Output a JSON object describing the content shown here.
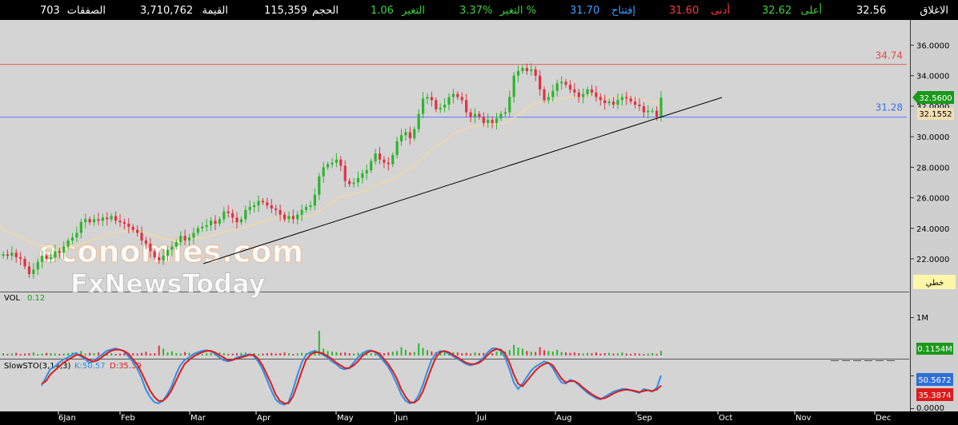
{
  "header": {
    "close_label": "الاغلاق",
    "close_value": "32.56",
    "high_label": "أعلى",
    "high_value": "32.62",
    "low_label": "أدنى",
    "low_value": "31.60",
    "open_label": "إفتتاح",
    "open_value": "31.70",
    "pct_label": "التغير %",
    "pct_value": "3.37%",
    "change_label": "التغير",
    "change_value": "1.06",
    "volume_label": "الحجم",
    "volume_value": "115,359",
    "value_label": "القيمة",
    "value_value": "3,710,762",
    "trades_label": "الصفقات",
    "trades_value": "703"
  },
  "colors": {
    "up": "#2db52d",
    "down": "#dd3344",
    "green_text": "#3fd13f",
    "red_text": "#ff3a3a",
    "blue_text": "#3aa0ff",
    "resistance": "#e06060",
    "support": "#5b7cff",
    "ma": "#efd9a8",
    "trend": "#000000",
    "sto_k": "#2f8fe8",
    "sto_d": "#dd1b1b"
  },
  "price_panel": {
    "resistance_label": "34.74",
    "support_label": "31.28",
    "last_price_badge": "32.5600",
    "ma_badge": "32.1552",
    "linear_badge": "خطي"
  },
  "volume_panel": {
    "label": "VOL",
    "value": "0.12",
    "axis_1m": "1M",
    "badge": "0.1154M"
  },
  "sto_panel": {
    "label": "SlowSTO(3,14,3)",
    "k_text": "K:50.57",
    "d_text": "D:35.39",
    "k_badge": "50.5672",
    "d_badge": "35.3874"
  },
  "watermark": {
    "line1": "economies.com",
    "line2": "FxNewsToday"
  },
  "chart_data": {
    "type": "candlestick",
    "price_ticks": [
      "36.0000",
      "34.0000",
      "32.0000",
      "30.0000",
      "28.0000",
      "26.0000",
      "24.0000",
      "22.0000"
    ],
    "y_price": [
      21,
      36.5
    ],
    "months": [
      "6Jan",
      "Feb",
      "Mar",
      "Apr",
      "May",
      "Jun",
      "Jul",
      "Aug",
      "Sep",
      "Oct",
      "Nov",
      "Dec"
    ],
    "sto_ticks": [
      "50.0000",
      "0.0000"
    ],
    "resistance": 34.74,
    "support": 31.28,
    "close_series": [
      22.3,
      22.2,
      22.4,
      22.1,
      22.0,
      21.5,
      21.0,
      21.3,
      21.8,
      22.2,
      22.0,
      22.1,
      22.5,
      22.4,
      22.8,
      23.2,
      23.4,
      23.7,
      24.4,
      24.6,
      24.4,
      24.6,
      24.5,
      24.7,
      24.6,
      24.8,
      24.5,
      24.4,
      24.3,
      24.1,
      23.9,
      23.7,
      23.2,
      23.0,
      22.5,
      22.1,
      21.9,
      22.2,
      22.6,
      22.8,
      23.1,
      23.5,
      23.2,
      23.4,
      23.7,
      24.0,
      24.1,
      24.2,
      24.5,
      24.3,
      24.6,
      25.1,
      25.0,
      24.7,
      24.4,
      24.6,
      25.2,
      25.4,
      25.5,
      25.8,
      25.7,
      25.5,
      25.3,
      25.2,
      24.9,
      24.6,
      24.8,
      24.6,
      24.9,
      25.2,
      25.4,
      25.5,
      26.2,
      27.4,
      28.0,
      28.2,
      28.3,
      28.5,
      28.1,
      27.1,
      26.9,
      27.0,
      27.3,
      27.6,
      27.8,
      28.4,
      28.9,
      28.5,
      28.3,
      28.2,
      28.8,
      29.7,
      30.1,
      30.3,
      29.9,
      30.5,
      31.5,
      32.5,
      32.6,
      32.4,
      31.8,
      31.9,
      32.1,
      32.6,
      32.8,
      32.6,
      32.4,
      31.6,
      31.3,
      31.5,
      31.3,
      30.9,
      31.1,
      30.9,
      31.2,
      31.5,
      31.6,
      32.6,
      34.0,
      34.3,
      34.5,
      34.3,
      34.4,
      34.0,
      33.1,
      32.4,
      32.6,
      33.0,
      33.5,
      33.6,
      33.4,
      33.1,
      32.9,
      32.6,
      32.8,
      33.1,
      32.9,
      32.6,
      32.4,
      32.2,
      32.3,
      32.1,
      32.4,
      32.6,
      32.5,
      32.3,
      32.1,
      32.0,
      31.6,
      31.7,
      31.7,
      31.3,
      32.56
    ],
    "volume_series": [
      0.06,
      0.04,
      0.05,
      0.07,
      0.04,
      0.05,
      0.06,
      0.08,
      0.04,
      0.05,
      0.07,
      0.06,
      0.05,
      0.04,
      0.05,
      0.06,
      0.08,
      0.06,
      0.12,
      0.05,
      0.07,
      0.06,
      0.08,
      0.04,
      0.05,
      0.06,
      0.04,
      0.05,
      0.07,
      0.04,
      0.06,
      0.05,
      0.07,
      0.1,
      0.05,
      0.06,
      0.26,
      0.18,
      0.08,
      0.11,
      0.06,
      0.05,
      0.09,
      0.07,
      0.06,
      0.05,
      0.04,
      0.06,
      0.07,
      0.05,
      0.08,
      0.06,
      0.04,
      0.05,
      0.06,
      0.07,
      0.08,
      0.05,
      0.06,
      0.04,
      0.05,
      0.06,
      0.07,
      0.05,
      0.06,
      0.08,
      0.06,
      0.04,
      0.05,
      0.07,
      0.06,
      0.08,
      0.15,
      0.65,
      0.18,
      0.12,
      0.1,
      0.09,
      0.07,
      0.08,
      0.06,
      0.05,
      0.07,
      0.09,
      0.08,
      0.06,
      0.05,
      0.07,
      0.06,
      0.08,
      0.1,
      0.12,
      0.22,
      0.15,
      0.08,
      0.09,
      0.32,
      0.2,
      0.14,
      0.11,
      0.09,
      0.08,
      0.07,
      0.1,
      0.09,
      0.08,
      0.06,
      0.07,
      0.05,
      0.08,
      0.06,
      0.07,
      0.05,
      0.06,
      0.1,
      0.09,
      0.11,
      0.14,
      0.28,
      0.21,
      0.18,
      0.12,
      0.1,
      0.09,
      0.22,
      0.14,
      0.12,
      0.1,
      0.15,
      0.09,
      0.08,
      0.07,
      0.08,
      0.06,
      0.05,
      0.07,
      0.06,
      0.08,
      0.05,
      0.06,
      0.07,
      0.05,
      0.06,
      0.08,
      0.05,
      0.04,
      0.06,
      0.05,
      0.04,
      0.05,
      0.06,
      0.04,
      0.12
    ],
    "sto_k_series": [
      35,
      48,
      60,
      64,
      70,
      75,
      78,
      82,
      85,
      80,
      76,
      70,
      72,
      78,
      83,
      88,
      90,
      92,
      90,
      88,
      80,
      72,
      62,
      48,
      30,
      18,
      10,
      8,
      12,
      22,
      34,
      52,
      66,
      74,
      78,
      83,
      86,
      88,
      89,
      88,
      84,
      78,
      74,
      72,
      74,
      78,
      80,
      82,
      83,
      80,
      72,
      60,
      44,
      28,
      14,
      8,
      6,
      10,
      28,
      50,
      70,
      82,
      86,
      88,
      86,
      82,
      78,
      72,
      68,
      62,
      60,
      62,
      70,
      78,
      84,
      88,
      89,
      86,
      80,
      72,
      64,
      52,
      38,
      22,
      12,
      8,
      10,
      20,
      36,
      56,
      74,
      84,
      88,
      87,
      84,
      80,
      76,
      72,
      68,
      66,
      68,
      72,
      78,
      86,
      92,
      92,
      88,
      78,
      60,
      40,
      30,
      38,
      48,
      58,
      64,
      68,
      72,
      70,
      62,
      50,
      40,
      38,
      44,
      42,
      36,
      30,
      24,
      20,
      16,
      14,
      18,
      22,
      26,
      28,
      30,
      30,
      28,
      26,
      24,
      30,
      28,
      26,
      32,
      50.57
    ],
    "sto_d_series": [
      38,
      42,
      52,
      58,
      64,
      70,
      74,
      78,
      82,
      82,
      78,
      74,
      72,
      74,
      79,
      84,
      88,
      90,
      90,
      88,
      84,
      76,
      68,
      56,
      42,
      28,
      18,
      12,
      12,
      18,
      28,
      42,
      56,
      68,
      74,
      79,
      83,
      86,
      88,
      88,
      86,
      82,
      78,
      74,
      74,
      76,
      78,
      80,
      82,
      82,
      76,
      66,
      52,
      38,
      22,
      12,
      8,
      8,
      18,
      36,
      56,
      74,
      82,
      86,
      86,
      84,
      80,
      76,
      70,
      66,
      62,
      62,
      66,
      72,
      80,
      85,
      88,
      87,
      84,
      76,
      68,
      58,
      46,
      30,
      18,
      10,
      9,
      14,
      26,
      44,
      62,
      78,
      86,
      88,
      86,
      82,
      78,
      74,
      70,
      68,
      68,
      70,
      75,
      82,
      88,
      91,
      90,
      84,
      70,
      52,
      38,
      34,
      42,
      50,
      58,
      64,
      68,
      70,
      66,
      56,
      46,
      40,
      42,
      42,
      38,
      32,
      27,
      22,
      18,
      15,
      16,
      19,
      23,
      26,
      28,
      29,
      28,
      27,
      25,
      27,
      28,
      27,
      29,
      35.39
    ]
  }
}
